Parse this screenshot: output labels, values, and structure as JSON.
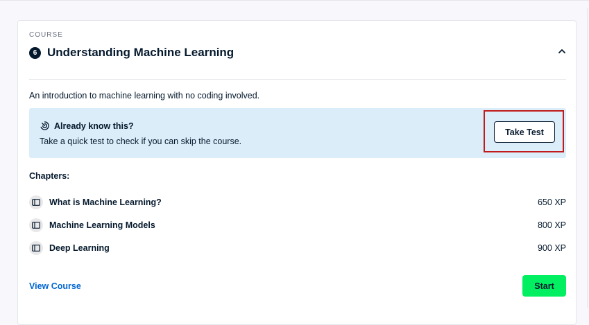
{
  "course": {
    "eyebrow": "COURSE",
    "number": "6",
    "title": "Understanding Machine Learning",
    "description": "An introduction to machine learning with no coding involved."
  },
  "banner": {
    "heading": "Already know this?",
    "subtext": "Take a quick test to check if you can skip the course.",
    "button_label": "Take Test",
    "icon": "gauge-icon",
    "highlight_color": "#c01a1a"
  },
  "chapters": {
    "label": "Chapters:",
    "items": [
      {
        "name": "What is Machine Learning?",
        "xp": "650 XP",
        "icon": "book-icon"
      },
      {
        "name": "Machine Learning Models",
        "xp": "800 XP",
        "icon": "book-icon"
      },
      {
        "name": "Deep Learning",
        "xp": "900 XP",
        "icon": "book-icon"
      }
    ]
  },
  "footer": {
    "view_course_label": "View Course",
    "start_label": "Start"
  },
  "colors": {
    "primary_text": "#05192d",
    "link": "#0065d1",
    "start_button": "#03ef62",
    "banner_bg": "#dbedf8"
  }
}
